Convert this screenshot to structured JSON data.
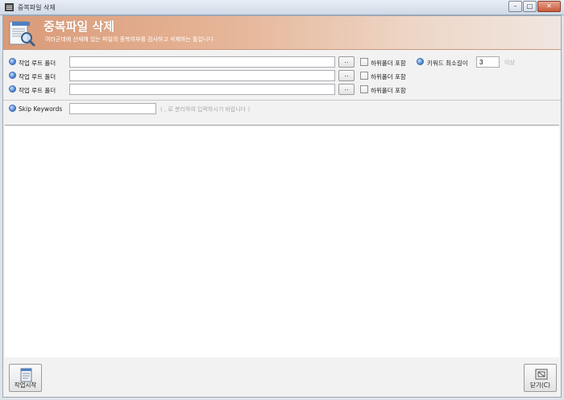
{
  "window": {
    "title": "중복파일 삭제",
    "min_label": "–",
    "max_label": "□",
    "close_label": "✕"
  },
  "banner": {
    "title": "중복파일 삭제",
    "subtitle": "여러군데에 산재해 있는 파일의 중복여부를 검사하고 삭제하는 툴입니다"
  },
  "form": {
    "folders": [
      {
        "label": "작업 루트 폴더",
        "value": "",
        "browse_label": "..",
        "checkbox_label": "하위폴더 포함",
        "checked": false
      },
      {
        "label": "작업 루트 폴더",
        "value": "",
        "browse_label": "..",
        "checkbox_label": "하위폴더 포함",
        "checked": false
      },
      {
        "label": "작업 루트 폴더",
        "value": "",
        "browse_label": "..",
        "checkbox_label": "하위폴더 포함",
        "checked": false
      }
    ],
    "keyword_min": {
      "label": "키워드 최소길이",
      "value": "3",
      "suffix": "이상"
    },
    "skip_keywords": {
      "label": "Skip Keywords",
      "value": "",
      "hint": "( , 로 분리하여 입력하시기 바랍니다 )"
    }
  },
  "footer": {
    "start_label": "작업시작",
    "close_label": "닫기(C)"
  },
  "colors": {
    "banner_start": "#d99a78",
    "bullet": "#5a8fd6"
  }
}
